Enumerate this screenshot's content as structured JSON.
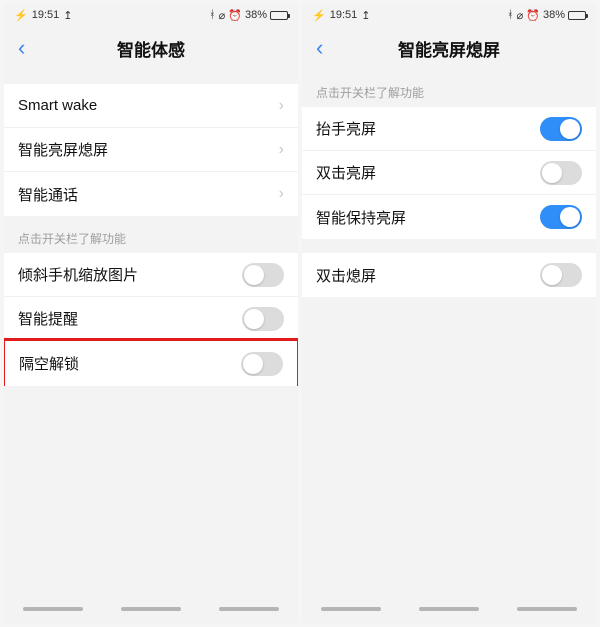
{
  "statusbar": {
    "time": "19:51",
    "battery_pct": "38%"
  },
  "left": {
    "title": "智能体感",
    "nav_rows": [
      {
        "label": "Smart wake"
      },
      {
        "label": "智能亮屏熄屏"
      },
      {
        "label": "智能通话"
      }
    ],
    "hint": "点击开关栏了解功能",
    "toggle_rows": [
      {
        "label": "倾斜手机缩放图片",
        "on": false
      },
      {
        "label": "智能提醒",
        "on": false
      },
      {
        "label": "隔空解锁",
        "on": false,
        "highlight": true
      }
    ]
  },
  "right": {
    "title": "智能亮屏熄屏",
    "hint": "点击开关栏了解功能",
    "group1": [
      {
        "label": "抬手亮屏",
        "on": true
      },
      {
        "label": "双击亮屏",
        "on": false
      },
      {
        "label": "智能保持亮屏",
        "on": true
      }
    ],
    "group2": [
      {
        "label": "双击熄屏",
        "on": false
      }
    ]
  }
}
